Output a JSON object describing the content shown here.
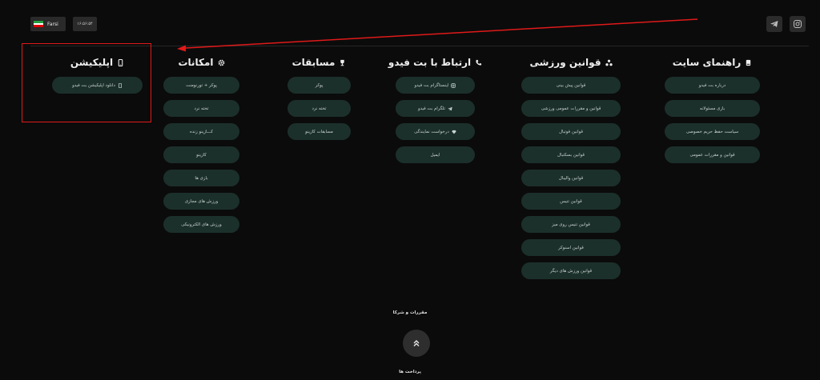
{
  "topbar": {
    "language": "Farsi",
    "clock": "۱۶:۵۶:۵۴",
    "flag_colors": [
      "#239f40",
      "#ffffff",
      "#da0000"
    ]
  },
  "columns": [
    {
      "key": "guide",
      "title": "راهنمای سایت",
      "icon": "book-icon",
      "items": [
        "درباره بت فیدو",
        "بازی مسئولانه",
        "سیاست حفظ حریم خصوصی",
        "قوانین و مقررات عمومی"
      ]
    },
    {
      "key": "sports-rules",
      "title": "قوانین ورزشی",
      "icon": "sitemap-icon",
      "items": [
        "قوانین پیش بینی",
        "قوانین و مقررات عمومی ورزشی",
        "قوانین فوتبال",
        "قوانین بسکتبال",
        "قوانین والیبال",
        "قوانین تنیس",
        "قوانین تنیس روی میز",
        "قوانین اسنوکر",
        "قوانین ورزش های دیگر"
      ]
    },
    {
      "key": "contact",
      "title": "ارتباط با بت فیدو",
      "icon": "phone-icon",
      "items": [
        {
          "label": "اینستاگرام بت فیدو",
          "icon": "instagram-icon"
        },
        {
          "label": "تلگرام بت فیدو",
          "icon": "telegram-icon"
        },
        {
          "label": "درخواست نمایندگی",
          "icon": "gem-icon"
        },
        {
          "label": "ایمیل",
          "icon": ""
        }
      ]
    },
    {
      "key": "tournaments",
      "title": "مسابقات",
      "icon": "trophy-icon",
      "items": [
        "پوکر",
        "تخته نرد",
        "مسابقات کازینو"
      ]
    },
    {
      "key": "features",
      "title": "امکانات",
      "icon": "gear-icon",
      "items": [
        "پوکر + تورنومنت",
        "تخته نرد",
        "کـــازینو زنده",
        "کازینو",
        "بازی ها",
        "ورزش های مجازی",
        "ورزش های الکترونیکی"
      ]
    },
    {
      "key": "app",
      "title": "اپلیکیشن",
      "icon": "mobile-icon",
      "items": [
        {
          "label": "دانلود اپلیکیشن بت فیدو",
          "icon": "mobile-icon"
        }
      ]
    }
  ],
  "footer": {
    "regulations": "مقررات و شرکا",
    "payments": "پرداخت ها"
  },
  "annotation_color": "#e01919"
}
